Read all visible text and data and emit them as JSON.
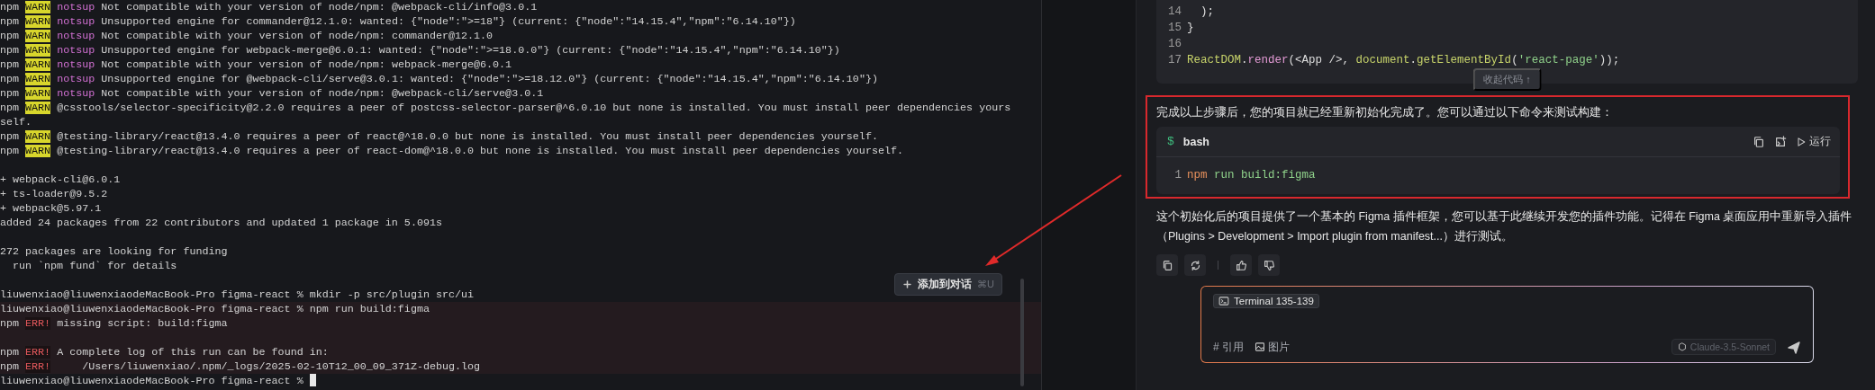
{
  "terminal": {
    "lines": [
      {
        "kind": "log",
        "prefix": "npm",
        "level": "WARN",
        "tag": "notsup",
        "text": "Not compatible with your version of node/npm: @webpack-cli/info@3.0.1"
      },
      {
        "kind": "log",
        "prefix": "npm",
        "level": "WARN",
        "tag": "notsup",
        "text": "Unsupported engine for commander@12.1.0: wanted: {\"node\":\">=18\"} (current: {\"node\":\"14.15.4\",\"npm\":\"6.14.10\"})"
      },
      {
        "kind": "log",
        "prefix": "npm",
        "level": "WARN",
        "tag": "notsup",
        "text": "Not compatible with your version of node/npm: commander@12.1.0"
      },
      {
        "kind": "log",
        "prefix": "npm",
        "level": "WARN",
        "tag": "notsup",
        "text": "Unsupported engine for webpack-merge@6.0.1: wanted: {\"node\":\">=18.0.0\"} (current: {\"node\":\"14.15.4\",\"npm\":\"6.14.10\"})"
      },
      {
        "kind": "log",
        "prefix": "npm",
        "level": "WARN",
        "tag": "notsup",
        "text": "Not compatible with your version of node/npm: webpack-merge@6.0.1"
      },
      {
        "kind": "log",
        "prefix": "npm",
        "level": "WARN",
        "tag": "notsup",
        "text": "Unsupported engine for @webpack-cli/serve@3.0.1: wanted: {\"node\":\">=18.12.0\"} (current: {\"node\":\"14.15.4\",\"npm\":\"6.14.10\"})"
      },
      {
        "kind": "log",
        "prefix": "npm",
        "level": "WARN",
        "tag": "notsup",
        "text": "Not compatible with your version of node/npm: @webpack-cli/serve@3.0.1"
      },
      {
        "kind": "log",
        "prefix": "npm",
        "level": "WARN",
        "text": "@csstools/selector-specificity@2.2.0 requires a peer of postcss-selector-parser@^6.0.10 but none is installed. You must install peer dependencies yours"
      },
      {
        "kind": "plain",
        "text": "self."
      },
      {
        "kind": "log",
        "prefix": "npm",
        "level": "WARN",
        "text": "@testing-library/react@13.4.0 requires a peer of react@^18.0.0 but none is installed. You must install peer dependencies yourself."
      },
      {
        "kind": "log",
        "prefix": "npm",
        "level": "WARN",
        "text": "@testing-library/react@13.4.0 requires a peer of react-dom@^18.0.0 but none is installed. You must install peer dependencies yourself."
      },
      {
        "kind": "blank"
      },
      {
        "kind": "plain",
        "text": "+ webpack-cli@6.0.1"
      },
      {
        "kind": "plain",
        "text": "+ ts-loader@9.5.2"
      },
      {
        "kind": "plain",
        "text": "+ webpack@5.97.1"
      },
      {
        "kind": "plain",
        "text": "added 24 packages from 22 contributors and updated 1 package in 5.091s"
      },
      {
        "kind": "blank"
      },
      {
        "kind": "plain",
        "text": "272 packages are looking for funding"
      },
      {
        "kind": "plain",
        "text": "  run `npm fund` for details"
      },
      {
        "kind": "blank"
      },
      {
        "kind": "plain",
        "text": "liuwenxiao@liuwenxiaodeMacBook-Pro figma-react % mkdir -p src/plugin src/ui"
      },
      {
        "kind": "plain",
        "highlighted": true,
        "text": "liuwenxiao@liuwenxiaodeMacBook-Pro figma-react % npm run build:figma"
      },
      {
        "kind": "log",
        "highlighted": true,
        "prefix": "npm",
        "level": "ERR!",
        "text": "missing script: build:figma"
      },
      {
        "kind": "blank",
        "highlighted": true
      },
      {
        "kind": "log",
        "highlighted": true,
        "prefix": "npm",
        "level": "ERR!",
        "text": "A complete log of this run can be found in:"
      },
      {
        "kind": "log",
        "highlighted": true,
        "prefix": "npm",
        "level": "ERR!",
        "text": "    /Users/liuwenxiao/.npm/_logs/2025-02-10T12_00_09_371Z-debug.log"
      },
      {
        "kind": "plain",
        "cursor": true,
        "text": "liuwenxiao@liuwenxiaodeMacBook-Pro figma-react %"
      }
    ],
    "add_to_chat": {
      "label": "添加到对话",
      "shortcut": "⌘U"
    }
  },
  "chat": {
    "code_block": {
      "lines": [
        {
          "number": "14",
          "tokens": [
            {
              "t": "  );",
              "kind": "punct"
            }
          ]
        },
        {
          "number": "15",
          "tokens": [
            {
              "t": "}",
              "kind": "punct"
            }
          ]
        },
        {
          "number": "16"
        },
        {
          "number": "17",
          "tokens": [
            {
              "t": "ReactDOM",
              "kind": "type"
            },
            {
              "t": ".",
              "kind": "punct"
            },
            {
              "t": "render",
              "kind": "fn"
            },
            {
              "t": "(<App />, ",
              "kind": "punct"
            },
            {
              "t": "document",
              "kind": "type"
            },
            {
              "t": ".",
              "kind": "punct"
            },
            {
              "t": "getElementById",
              "kind": "method"
            },
            {
              "t": "(",
              "kind": "punct"
            },
            {
              "t": "'react-page'",
              "kind": "string"
            },
            {
              "t": "));",
              "kind": "punct"
            }
          ]
        }
      ],
      "collapse_label": "收起代码 ↑"
    },
    "intro": "完成以上步骤后，您的项目就已经重新初始化完成了。您可以通过以下命令来测试构建：",
    "bash_block": {
      "prompt": "$",
      "language": "bash",
      "run_label": "运行",
      "lines": [
        {
          "number": "1",
          "tokens": [
            {
              "t": "npm",
              "kind": "keyword"
            },
            {
              "t": " run build:figma",
              "kind": "string"
            }
          ]
        }
      ]
    },
    "summary": "这个初始化后的项目提供了一个基本的 Figma 插件框架，您可以基于此继续开发您的插件功能。记得在 Figma 桌面应用中重新导入插件（Plugins > Development > Import plugin from manifest...）进行测试。",
    "input": {
      "context_chip": "Terminal 135-139",
      "reference_label": "# 引用",
      "image_label": "图片",
      "model": "Claude-3.5-Sonnet"
    }
  }
}
